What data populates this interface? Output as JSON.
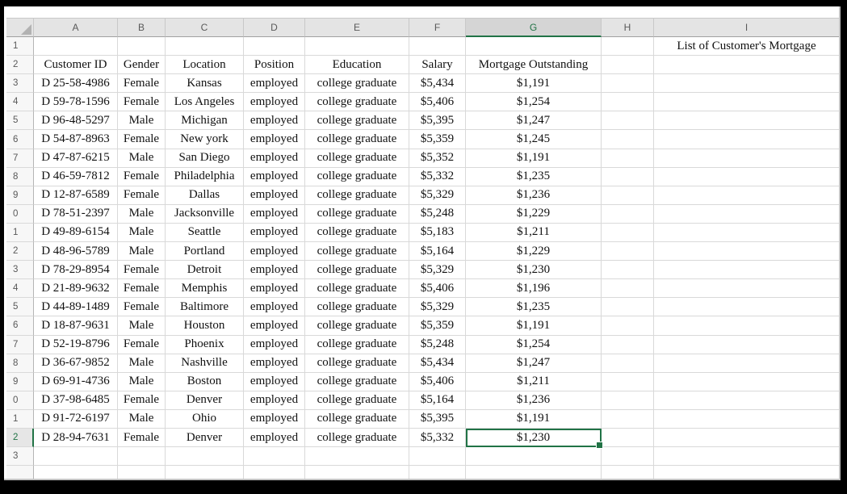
{
  "sheet": {
    "column_letters": [
      "A",
      "B",
      "C",
      "D",
      "E",
      "F",
      "G",
      "H",
      "I"
    ],
    "row_labels_visible": [
      "1",
      "2",
      "3",
      "4",
      "5",
      "6",
      "7",
      "8",
      "9",
      "0",
      "1",
      "2",
      "3",
      "4",
      "5",
      "6",
      "7",
      "8",
      "9",
      "0",
      "1",
      "2",
      "3"
    ],
    "title_note": {
      "cell_ref": "I1",
      "text": "List of Customer's Mortgage"
    },
    "table_headers": [
      "Customer ID",
      "Gender",
      "Location",
      "Position",
      "Education",
      "Salary",
      "Mortgage Outstanding"
    ],
    "records": [
      {
        "customer_id": "D 25-58-4986",
        "gender": "Female",
        "location": "Kansas",
        "position": "employed",
        "education": "college graduate",
        "salary": "$5,434",
        "mortgage": "$1,191"
      },
      {
        "customer_id": "D 59-78-1596",
        "gender": "Female",
        "location": "Los Angeles",
        "position": "employed",
        "education": "college graduate",
        "salary": "$5,406",
        "mortgage": "$1,254"
      },
      {
        "customer_id": "D 96-48-5297",
        "gender": "Male",
        "location": "Michigan",
        "position": "employed",
        "education": "college graduate",
        "salary": "$5,395",
        "mortgage": "$1,247"
      },
      {
        "customer_id": "D 54-87-8963",
        "gender": "Female",
        "location": "New york",
        "position": "employed",
        "education": "college graduate",
        "salary": "$5,359",
        "mortgage": "$1,245"
      },
      {
        "customer_id": "D 47-87-6215",
        "gender": "Male",
        "location": "San Diego",
        "position": "employed",
        "education": "college graduate",
        "salary": "$5,352",
        "mortgage": "$1,191"
      },
      {
        "customer_id": "D 46-59-7812",
        "gender": "Female",
        "location": "Philadelphia",
        "position": "employed",
        "education": "college graduate",
        "salary": "$5,332",
        "mortgage": "$1,235"
      },
      {
        "customer_id": "D 12-87-6589",
        "gender": "Female",
        "location": "Dallas",
        "position": "employed",
        "education": "college graduate",
        "salary": "$5,329",
        "mortgage": "$1,236"
      },
      {
        "customer_id": "D 78-51-2397",
        "gender": "Male",
        "location": "Jacksonville",
        "position": "employed",
        "education": "college graduate",
        "salary": "$5,248",
        "mortgage": "$1,229"
      },
      {
        "customer_id": "D 49-89-6154",
        "gender": "Male",
        "location": "Seattle",
        "position": "employed",
        "education": "college graduate",
        "salary": "$5,183",
        "mortgage": "$1,211"
      },
      {
        "customer_id": "D 48-96-5789",
        "gender": "Male",
        "location": "Portland",
        "position": "employed",
        "education": "college graduate",
        "salary": "$5,164",
        "mortgage": "$1,229"
      },
      {
        "customer_id": "D 78-29-8954",
        "gender": "Female",
        "location": "Detroit",
        "position": "employed",
        "education": "college graduate",
        "salary": "$5,329",
        "mortgage": "$1,230"
      },
      {
        "customer_id": "D 21-89-9632",
        "gender": "Female",
        "location": "Memphis",
        "position": "employed",
        "education": "college graduate",
        "salary": "$5,406",
        "mortgage": "$1,196"
      },
      {
        "customer_id": "D 44-89-1489",
        "gender": "Female",
        "location": "Baltimore",
        "position": "employed",
        "education": "college graduate",
        "salary": "$5,329",
        "mortgage": "$1,235"
      },
      {
        "customer_id": "D 18-87-9631",
        "gender": "Male",
        "location": "Houston",
        "position": "employed",
        "education": "college graduate",
        "salary": "$5,359",
        "mortgage": "$1,191"
      },
      {
        "customer_id": "D 52-19-8796",
        "gender": "Female",
        "location": "Phoenix",
        "position": "employed",
        "education": "college graduate",
        "salary": "$5,248",
        "mortgage": "$1,254"
      },
      {
        "customer_id": "D 36-67-9852",
        "gender": "Male",
        "location": "Nashville",
        "position": "employed",
        "education": "college graduate",
        "salary": "$5,434",
        "mortgage": "$1,247"
      },
      {
        "customer_id": "D 69-91-4736",
        "gender": "Male",
        "location": "Boston",
        "position": "employed",
        "education": "college graduate",
        "salary": "$5,406",
        "mortgage": "$1,211"
      },
      {
        "customer_id": "D 37-98-6485",
        "gender": "Female",
        "location": "Denver",
        "position": "employed",
        "education": "college graduate",
        "salary": "$5,164",
        "mortgage": "$1,236"
      },
      {
        "customer_id": "D 91-72-6197",
        "gender": "Male",
        "location": "Ohio",
        "position": "employed",
        "education": "college graduate",
        "salary": "$5,395",
        "mortgage": "$1,191"
      },
      {
        "customer_id": "D 28-94-7631",
        "gender": "Female",
        "location": "Denver",
        "position": "employed",
        "education": "college graduate",
        "salary": "$5,332",
        "mortgage": "$1,230"
      }
    ],
    "selection": {
      "cell_ref": "G22",
      "column": "G",
      "row": "22",
      "value": "$1,230"
    },
    "colors": {
      "accent_green": "#217346",
      "header_bg": "#e4e4e4",
      "selected_header_bg": "#d5d5d5",
      "gridline": "#d9d9d9",
      "frame": "#000000"
    }
  }
}
